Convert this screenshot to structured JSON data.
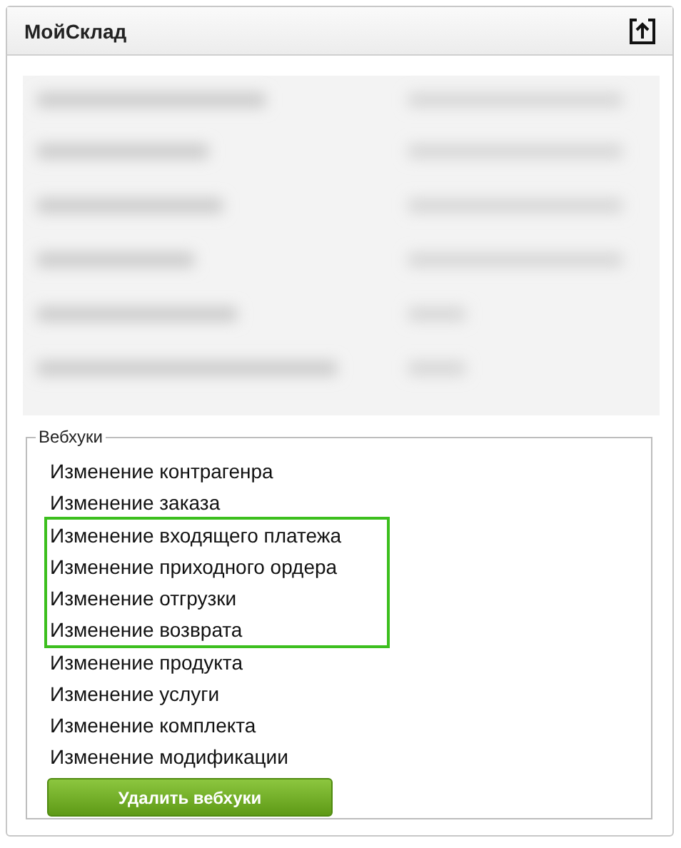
{
  "panel": {
    "title": "МойСклад"
  },
  "redacted_area": {
    "kind": "blurred"
  },
  "webhooks": {
    "legend": "Вебхуки",
    "items": [
      {
        "label": "Изменение контрагенра",
        "highlighted": false
      },
      {
        "label": "Изменение заказа",
        "highlighted": false
      },
      {
        "label": "Изменение входящего платежа",
        "highlighted": true
      },
      {
        "label": "Изменение приходного ордера",
        "highlighted": true
      },
      {
        "label": "Изменение отгрузки",
        "highlighted": true
      },
      {
        "label": "Изменение возврата",
        "highlighted": true
      },
      {
        "label": "Изменение продукта",
        "highlighted": false
      },
      {
        "label": "Изменение услуги",
        "highlighted": false
      },
      {
        "label": "Изменение комплекта",
        "highlighted": false
      },
      {
        "label": "Изменение модификации",
        "highlighted": false
      }
    ],
    "button": "Удалить вебхуки"
  }
}
